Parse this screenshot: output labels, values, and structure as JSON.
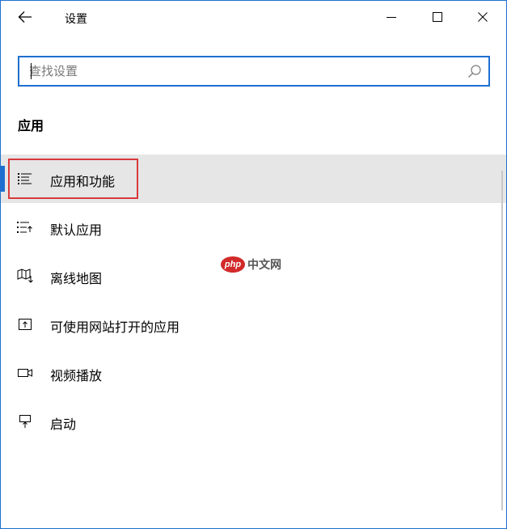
{
  "window": {
    "title": "设置",
    "controls": {
      "back": "back-arrow-icon",
      "minimize": "minimize-icon",
      "maximize": "maximize-icon",
      "close": "close-icon"
    }
  },
  "search": {
    "placeholder": "查找设置",
    "value": "",
    "icon": "search-icon"
  },
  "section": {
    "heading": "应用"
  },
  "nav": {
    "items": [
      {
        "label": "应用和功能",
        "icon": "apps-features-list-icon",
        "selected": true,
        "highlighted": true
      },
      {
        "label": "默认应用",
        "icon": "default-apps-icon",
        "selected": false
      },
      {
        "label": "离线地图",
        "icon": "offline-maps-icon",
        "selected": false
      },
      {
        "label": "可使用网站打开的应用",
        "icon": "apps-for-websites-icon",
        "selected": false
      },
      {
        "label": "视频播放",
        "icon": "video-camera-icon",
        "selected": false
      },
      {
        "label": "启动",
        "icon": "startup-monitor-icon",
        "selected": false
      }
    ]
  },
  "watermark": {
    "logo_text": "php",
    "text": "中文网"
  },
  "colors": {
    "accent": "#1e6fd0",
    "selected_bg": "#e6e6e6",
    "highlight_border": "#d9393b",
    "watermark": "#d22a2a"
  }
}
